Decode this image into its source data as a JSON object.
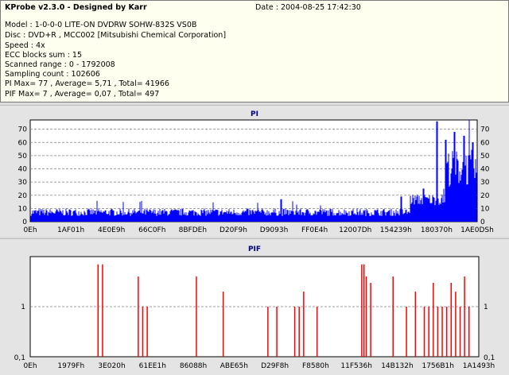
{
  "header": {
    "title": "KProbe v2.3.0 - Designed by Karr",
    "date": "Date : 2004-08-25 17:42:30",
    "lines": [
      "Model : 1-0-0-0 LITE-ON DVDRW SOHW-832S  VS0B",
      "Disc : DVD+R , MCC002 [Mitsubishi Chemical Corporation]",
      "Speed : 4x",
      "ECC blocks sum : 15",
      "Scanned range : 0 - 1792008",
      "Sampling count : 102606",
      "PI Max= 77 , Average= 5,71 , Total= 41966",
      "PIF Max= 7 , Average= 0,07 , Total= 497"
    ]
  },
  "chart_data": [
    {
      "type": "bar",
      "title": "PI",
      "y_ticks": [
        "70",
        "60",
        "50",
        "40",
        "30",
        "20",
        "10",
        "0"
      ],
      "ylim": [
        0,
        77
      ],
      "x_ticks": [
        "0Eh",
        "1AF01h",
        "4E0E9h",
        "66C0Fh",
        "8BFDEh",
        "D20F9h",
        "D9093h",
        "FF0E4h",
        "12007Dh",
        "154239h",
        "180370h",
        "1AE0DSh"
      ],
      "color": "#0000ff",
      "segments": [
        {
          "from": 0.0,
          "to": 0.85,
          "typical": 6,
          "spread": 4
        },
        {
          "from": 0.85,
          "to": 0.93,
          "typical": 15,
          "spread": 6
        },
        {
          "from": 0.93,
          "to": 1.0,
          "typical": 35,
          "spread": 20
        }
      ],
      "peaks": [
        [
          0.91,
          76
        ],
        [
          0.95,
          68
        ],
        [
          0.97,
          65
        ],
        [
          0.93,
          62
        ],
        [
          0.99,
          60
        ],
        [
          0.88,
          25
        ],
        [
          0.83,
          19
        ],
        [
          0.56,
          17
        ]
      ]
    },
    {
      "type": "bar",
      "title": "PIF",
      "y_ticks": [
        "1",
        "0,1"
      ],
      "scale": "log",
      "x_ticks": [
        "0Eh",
        "1979Fh",
        "3E020h",
        "61EE1h",
        "86088h",
        "ABE65h",
        "D29F8h",
        "F8580h",
        "11F536h",
        "14B132h",
        "1756B1h",
        "1A1493h"
      ],
      "color": "#ff0000",
      "values": [
        [
          0.15,
          7
        ],
        [
          0.16,
          7
        ],
        [
          0.24,
          4
        ],
        [
          0.25,
          1
        ],
        [
          0.26,
          1
        ],
        [
          0.37,
          4
        ],
        [
          0.43,
          2
        ],
        [
          0.53,
          1
        ],
        [
          0.55,
          1
        ],
        [
          0.59,
          1
        ],
        [
          0.6,
          1
        ],
        [
          0.61,
          2
        ],
        [
          0.64,
          1
        ],
        [
          0.74,
          7
        ],
        [
          0.745,
          7
        ],
        [
          0.75,
          4
        ],
        [
          0.76,
          3
        ],
        [
          0.81,
          4
        ],
        [
          0.84,
          1
        ],
        [
          0.86,
          2
        ],
        [
          0.88,
          1
        ],
        [
          0.89,
          1
        ],
        [
          0.9,
          3
        ],
        [
          0.91,
          1
        ],
        [
          0.92,
          1
        ],
        [
          0.93,
          1
        ],
        [
          0.94,
          3
        ],
        [
          0.95,
          2
        ],
        [
          0.96,
          1
        ],
        [
          0.97,
          4
        ],
        [
          0.98,
          1
        ]
      ]
    }
  ]
}
